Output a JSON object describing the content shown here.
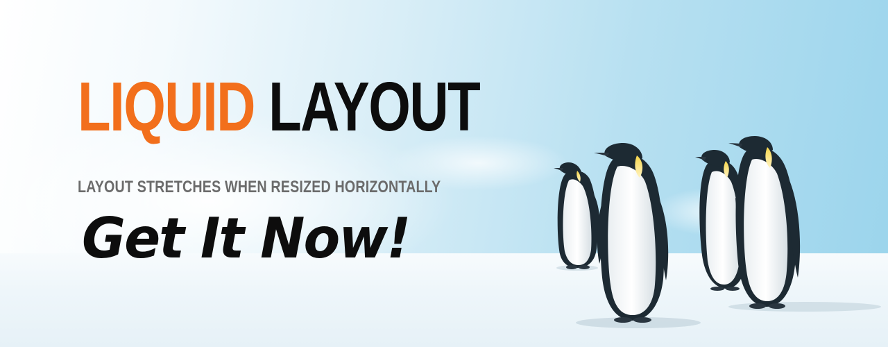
{
  "banner": {
    "headline_accent": "LIQUID",
    "headline_main": "LAYOUT",
    "subheadline": "LAYOUT STRETCHES WHEN RESIZED HORIZONTALLY",
    "cta": "Get It Now!"
  },
  "colors": {
    "accent": "#f26f1c",
    "text_dark": "#0d0d0d",
    "text_gray": "#6b6b6b",
    "sky": "#9ad4ec"
  },
  "image": {
    "subject": "penguins-icon"
  }
}
